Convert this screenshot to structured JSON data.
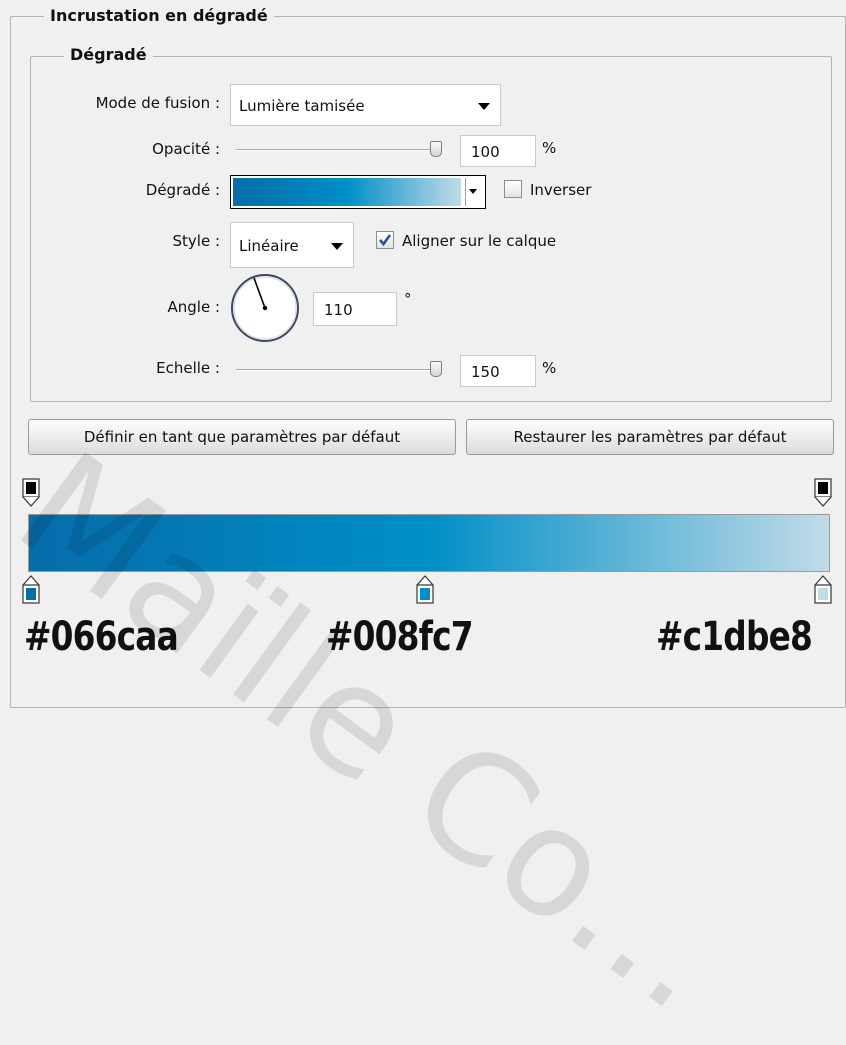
{
  "panel": {
    "title": "Incrustation en dégradé",
    "subgroup_title": "Dégradé"
  },
  "fields": {
    "blend_mode": {
      "label": "Mode de fusion :",
      "value": "Lumière tamisée"
    },
    "opacity": {
      "label": "Opacité :",
      "value": "100",
      "unit": "%",
      "level": 1.0
    },
    "gradient": {
      "label": "Dégradé :",
      "reverse_label": "Inverser",
      "reverse_checked": false
    },
    "style": {
      "label": "Style :",
      "value": "Linéaire",
      "align_label": "Aligner sur le calque",
      "align_checked": true
    },
    "angle": {
      "label": "Angle :",
      "value": "110",
      "unit": "°"
    },
    "scale": {
      "label": "Echelle :",
      "value": "150",
      "unit": "%",
      "level": 1.0
    }
  },
  "buttons": {
    "make_default": "Définir en tant que paramètres par défaut",
    "reset_default": "Restaurer les paramètres par défaut"
  },
  "gradient_colors": {
    "start": "#066caa",
    "mid": "#008fc7",
    "end": "#c1dbe8"
  },
  "color_labels": [
    "#066caa",
    "#008fc7",
    "#c1dbe8"
  ],
  "watermark": "Maïlle Co..."
}
